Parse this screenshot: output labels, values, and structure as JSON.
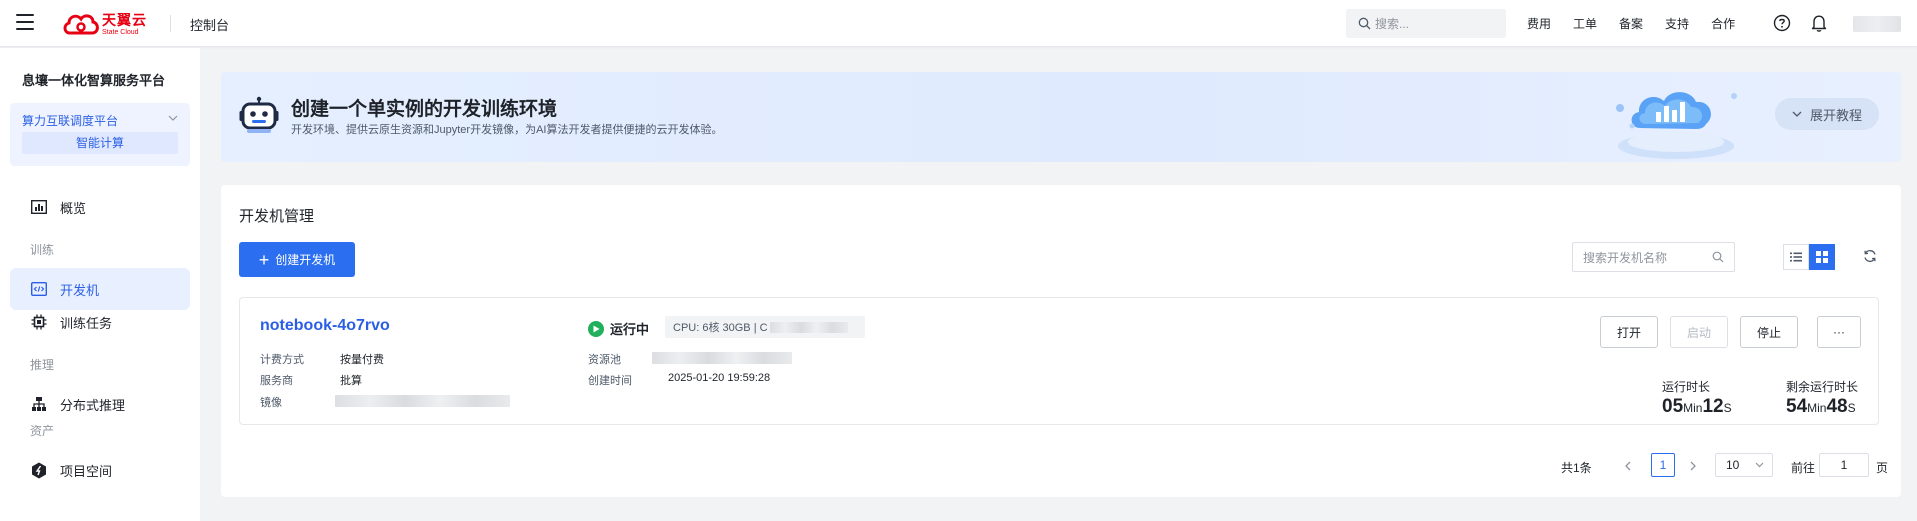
{
  "topbar": {
    "logo_cn": "天翼云",
    "logo_en": "State Cloud",
    "console": "控制台",
    "search_placeholder": "搜索...",
    "links": [
      "费用",
      "工单",
      "备案",
      "支持",
      "合作"
    ]
  },
  "sidebar": {
    "title": "息壤一体化智算服务平台",
    "platform": "算力互联调度平台",
    "platform_sub": "智能计算",
    "items": [
      {
        "label": "概览",
        "icon": "chart-icon"
      },
      {
        "label": "开发机",
        "icon": "code-icon",
        "active": true
      },
      {
        "label": "训练任务",
        "icon": "chip-icon"
      },
      {
        "label": "分布式推理",
        "icon": "hierarchy-icon"
      },
      {
        "label": "项目空间",
        "icon": "cube-icon"
      }
    ],
    "groups": [
      "训练",
      "推理",
      "资产"
    ]
  },
  "banner": {
    "title": "创建一个单实例的开发训练环境",
    "desc": "开发环境、提供云原生资源和Jupyter开发镜像，为AI算法开发者提供便捷的云开发体验。",
    "tutorial": "展开教程"
  },
  "main": {
    "title": "开发机管理",
    "create_label": "创建开发机",
    "search_placeholder": "搜索开发机名称"
  },
  "instance": {
    "name": "notebook-4o7rvo",
    "billing_label": "计费方式",
    "billing_value": "按量付费",
    "provider_label": "服务商",
    "provider_value": "批算",
    "image_label": "镜像",
    "status": "运行中",
    "spec": "CPU: 6核 30GB | C",
    "pool_label": "资源池",
    "created_label": "创建时间",
    "created_value": "2025-01-20 19:59:28",
    "actions": {
      "open": "打开",
      "start": "启动",
      "stop": "停止",
      "more": "···"
    },
    "run_label": "运行时长",
    "run_min": "05",
    "run_sec": "12",
    "remain_label": "剩余运行时长",
    "remain_min": "54",
    "remain_sec": "48",
    "min_unit": "Min",
    "sec_unit": "S"
  },
  "pagination": {
    "total": "共1条",
    "current": "1",
    "page_size": "10",
    "goto_label": "前往",
    "goto_value": "1",
    "page_suffix": "页"
  },
  "colors": {
    "brand": "#e60012",
    "accent": "#2b6ff0",
    "running": "#22b05c"
  }
}
